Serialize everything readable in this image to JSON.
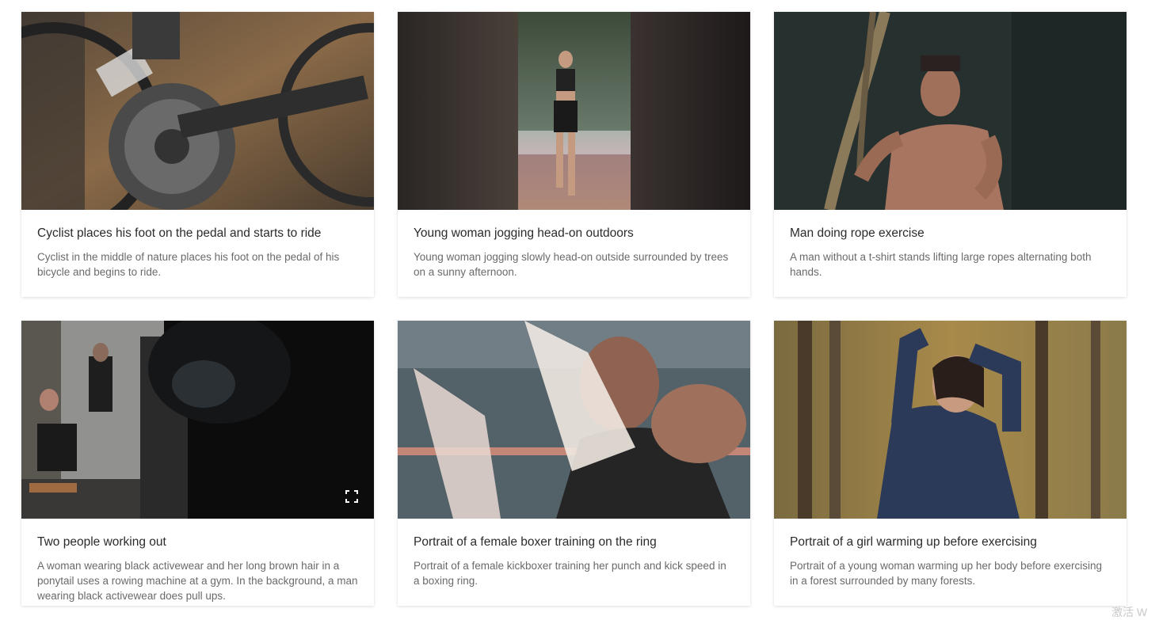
{
  "cards": [
    {
      "title": "Cyclist places his foot on the pedal and starts to ride",
      "description": "Cyclist in the middle of nature places his foot on the pedal of his bicycle and begins to ride."
    },
    {
      "title": "Young woman jogging head-on outdoors",
      "description": "Young woman jogging slowly head-on outside surrounded by trees on a sunny afternoon."
    },
    {
      "title": "Man doing rope exercise",
      "description": "A man without a t-shirt stands lifting large ropes alternating both hands."
    },
    {
      "title": "Two people working out",
      "description": "A woman wearing black activewear and her long brown hair in a ponytail uses a rowing machine at a gym. In the background, a man wearing black activewear does pull ups."
    },
    {
      "title": "Portrait of a female boxer training on the ring",
      "description": "Portrait of a female kickboxer training her punch and kick speed in a boxing ring."
    },
    {
      "title": "Portrait of a girl warming up before exercising",
      "description": "Portrait of a young woman warming up her body before exercising in a forest surrounded by many forests."
    }
  ],
  "icons": {
    "fullscreen": "fullscreen-icon"
  },
  "watermark": "激活 W"
}
